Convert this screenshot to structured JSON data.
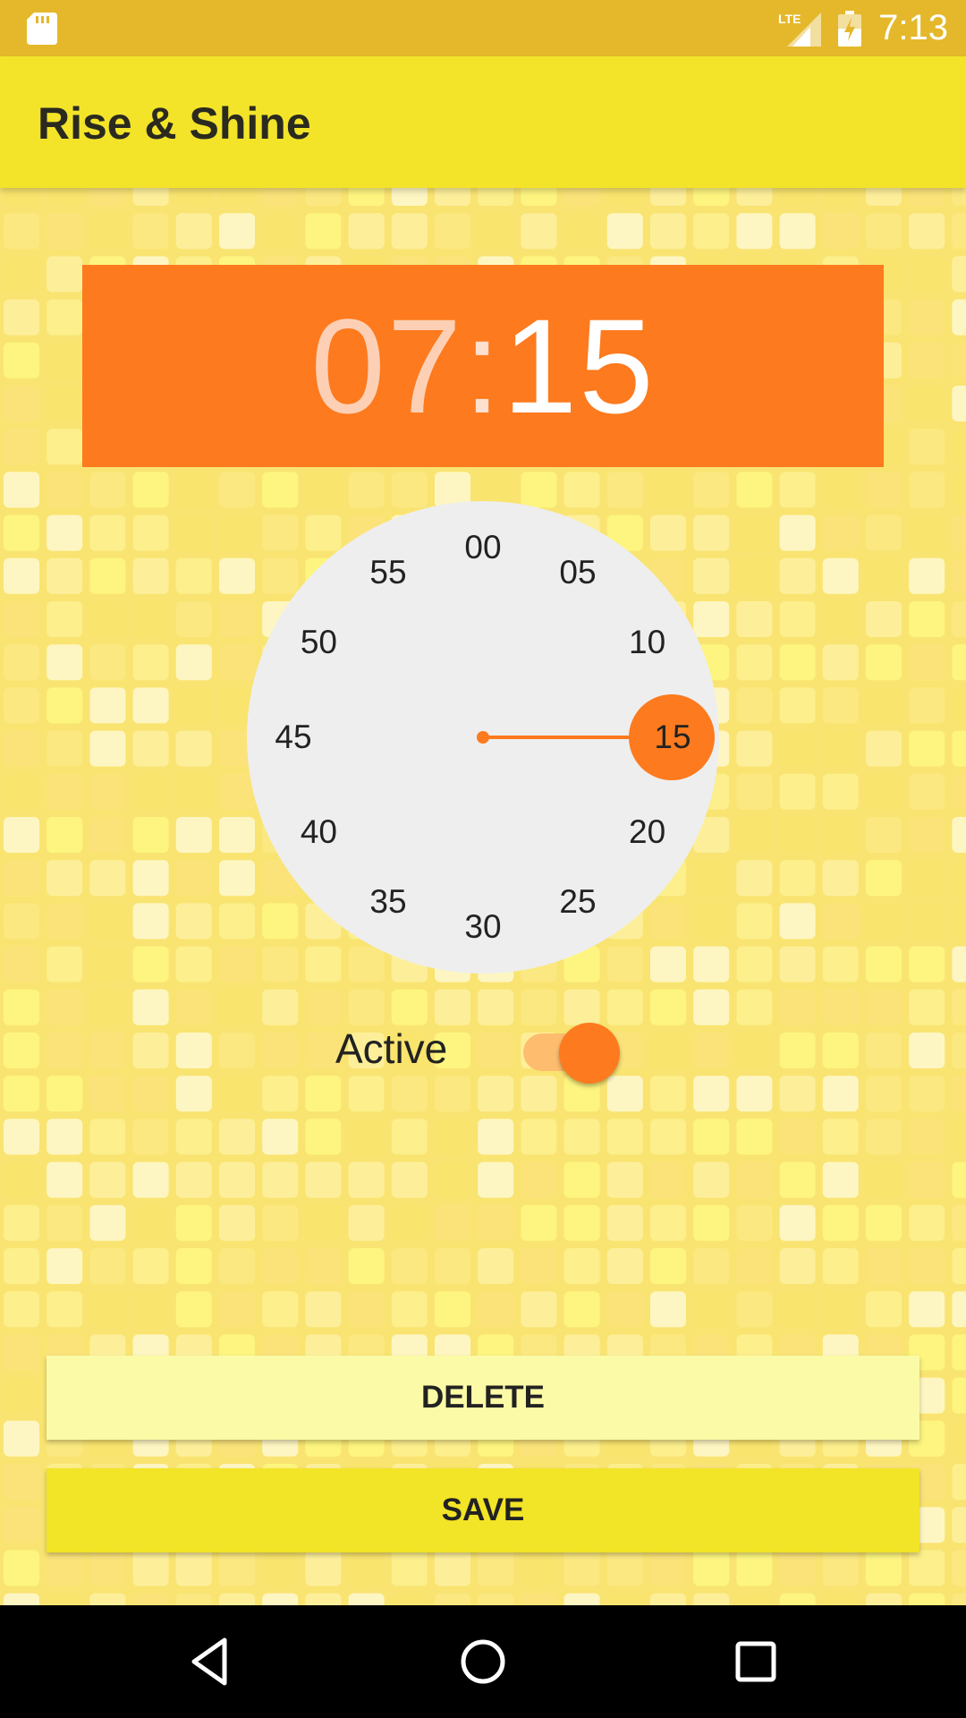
{
  "status_bar": {
    "time": "7:13",
    "network_label": "LTE",
    "icons": [
      "sd-card-icon",
      "signal-icon",
      "battery-charging-icon"
    ]
  },
  "app_bar": {
    "title": "Rise & Shine"
  },
  "alarm": {
    "hours": "07",
    "separator": ":",
    "minutes": "15"
  },
  "dial": {
    "numbers": [
      "00",
      "05",
      "10",
      "15",
      "20",
      "25",
      "30",
      "35",
      "40",
      "45",
      "50",
      "55"
    ],
    "selected": "15"
  },
  "active_toggle": {
    "label": "Active",
    "checked": true
  },
  "buttons": {
    "delete": "DELETE",
    "save": "SAVE"
  },
  "nav": {
    "icons": [
      "back-icon",
      "home-icon",
      "recents-icon"
    ]
  },
  "colors": {
    "status_bar": "#e4b82a",
    "app_bar": "#f3e42a",
    "accent": "#fd7a1e",
    "dial_face": "#eeeeee",
    "delete_button": "#fbfaa6",
    "save_button": "#f2e426",
    "background": "#f9e472"
  }
}
